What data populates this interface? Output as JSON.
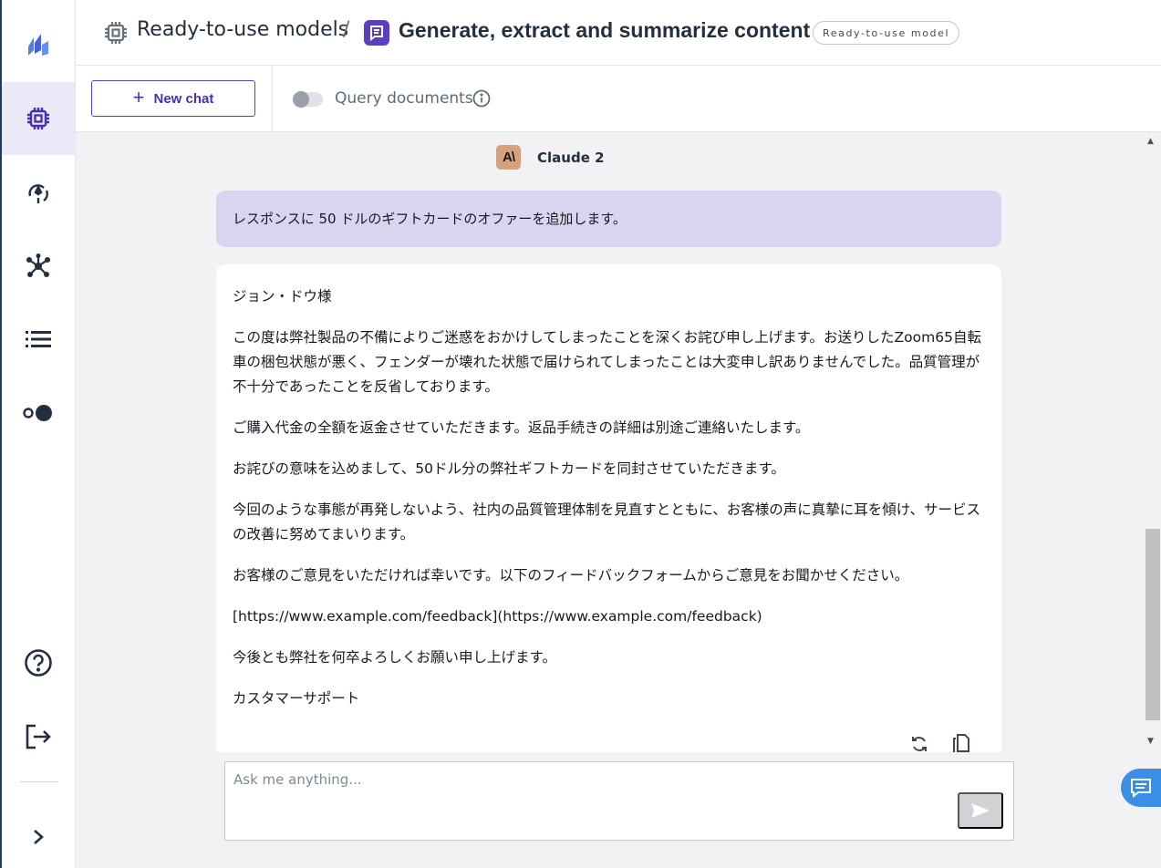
{
  "rail": {
    "items": [
      {
        "name": "logo-icon"
      },
      {
        "name": "models-icon",
        "active": true
      },
      {
        "name": "deploy-icon"
      },
      {
        "name": "network-icon"
      },
      {
        "name": "list-icon"
      },
      {
        "name": "toggle-view-icon"
      },
      {
        "name": "help-icon"
      },
      {
        "name": "signout-icon"
      },
      {
        "name": "expand-icon"
      }
    ]
  },
  "header": {
    "crumb_root": "Ready-to-use models",
    "separator": "/",
    "current": "Generate, extract and summarize content",
    "badge": "Ready-to-use model"
  },
  "toolbar": {
    "new_chat_plus": "+",
    "new_chat_label": "New chat",
    "query_label": "Query documents",
    "query_enabled": false
  },
  "chat": {
    "model_logo_text": "A\\",
    "model_name": "Claude 2",
    "user_message": "レスポンスに 50 ドルのギフトカードのオファーを追加します。",
    "bot_paragraphs": [
      "ジョン・ドウ様",
      "この度は弊社製品の不備によりご迷惑をおかけしてしまったことを深くお詫び申し上げます。お送りしたZoom65自転車の梱包状態が悪く、フェンダーが壊れた状態で届けられてしまったことは大変申し訳ありませんでした。品質管理が不十分であったことを反省しております。",
      "ご購入代金の全額を返金させていただきます。返品手続きの詳細は別途ご連絡いたします。",
      "お詫びの意味を込めまして、50ドル分の弊社ギフトカードを同封させていただきます。",
      "今回のような事態が再発しないよう、社内の品質管理体制を見直すとともに、お客様の声に真摯に耳を傾け、サービスの改善に努めてまいります。",
      "お客様のご意見をいただければ幸いです。以下のフィードバックフォームからご意見をお聞かせください。",
      "[https://www.example.com/feedback](https://www.example.com/feedback)",
      "今後とも弊社を何卒よろしくお願い申し上げます。",
      "カスタマーサポート"
    ]
  },
  "input": {
    "placeholder": "Ask me anything...",
    "value": ""
  },
  "colors": {
    "accent": "#5a3fc0",
    "user_bubble": "#d9d4ef",
    "help_fab": "#3a8ee6"
  }
}
